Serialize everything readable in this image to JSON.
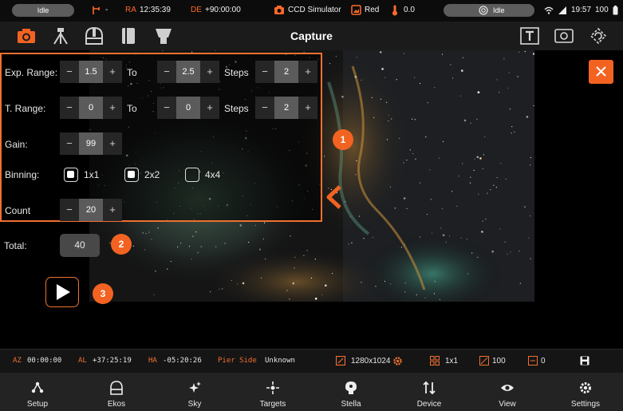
{
  "status_bar": {
    "left_status": "Idle",
    "mount_symbol": "-",
    "ra_label": "RA",
    "ra_value": "12:35:39",
    "de_label": "DE",
    "de_value": "+90:00:00",
    "camera": "CCD Simulator",
    "filter": "Red",
    "temperature": "0.0",
    "right_status": "Idle",
    "time": "19:57",
    "battery": "100"
  },
  "toolbar": {
    "title": "Capture"
  },
  "capture_panel": {
    "exp_range": {
      "label": "Exp. Range:",
      "from": "1.5",
      "to_label": "To",
      "to": "2.5",
      "steps_label": "Steps",
      "steps": "2"
    },
    "t_range": {
      "label": "T. Range:",
      "from": "0",
      "to_label": "To",
      "to": "0",
      "steps_label": "Steps",
      "steps": "2"
    },
    "gain": {
      "label": "Gain:",
      "value": "99"
    },
    "binning": {
      "label": "Binning:",
      "options": [
        "1x1",
        "2x2",
        "4x4"
      ],
      "checked": [
        true,
        true,
        false
      ]
    },
    "count": {
      "label": "Count",
      "value": "20"
    },
    "minus": "−",
    "plus": "+"
  },
  "total": {
    "label": "Total:",
    "value": "40"
  },
  "badges": [
    "1",
    "2",
    "3"
  ],
  "info_bar": {
    "az_label": "AZ",
    "az_value": "00:00:00",
    "al_label": "AL",
    "al_value": "+37:25:19",
    "ha_label": "HA",
    "ha_value": "-05:20:26",
    "pier_label": "Pier Side",
    "pier_value": "Unknown",
    "resolution": "1280x1024",
    "binning": "1x1",
    "gain": "100",
    "offset": "0"
  },
  "nav": [
    {
      "label": "Setup",
      "icon": "setup-icon"
    },
    {
      "label": "Ekos",
      "icon": "ekos-icon"
    },
    {
      "label": "Sky",
      "icon": "sky-icon"
    },
    {
      "label": "Targets",
      "icon": "targets-icon"
    },
    {
      "label": "Stella",
      "icon": "stella-icon"
    },
    {
      "label": "Device",
      "icon": "device-icon"
    },
    {
      "label": "View",
      "icon": "view-icon"
    },
    {
      "label": "Settings",
      "icon": "settings-icon"
    }
  ],
  "colors": {
    "accent": "#f26322",
    "panel_border": "#f07030",
    "background": "#000000"
  }
}
